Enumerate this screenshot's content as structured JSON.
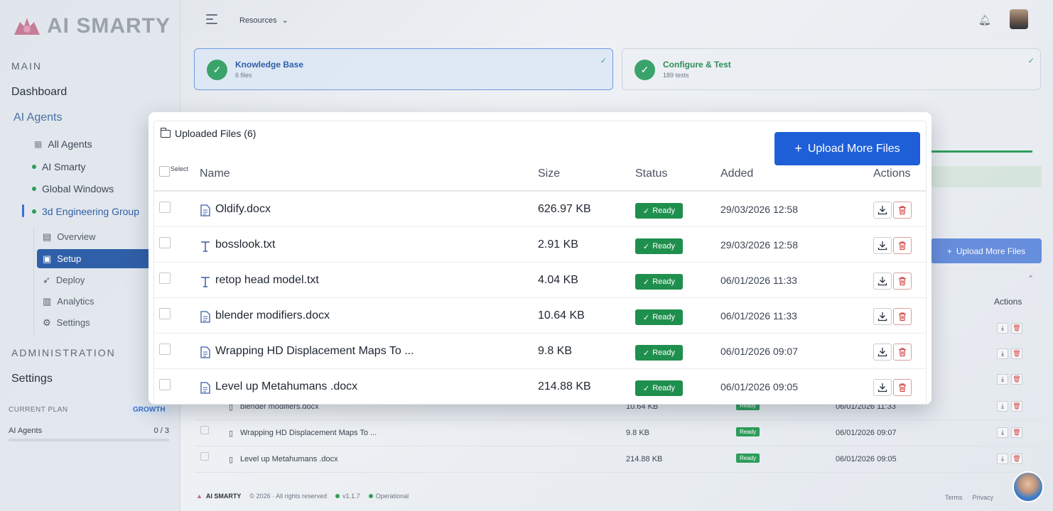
{
  "app": {
    "name": "AI SMARTY"
  },
  "sidebar": {
    "main_label": "MAIN",
    "dashboard": "Dashboard",
    "ai_agents": "AI Agents",
    "agents": [
      {
        "label": "All Agents",
        "icon": "grid-icon"
      },
      {
        "label": "AI Smarty",
        "icon": "status-dot"
      },
      {
        "label": "Global Windows",
        "icon": "status-dot"
      },
      {
        "label": "3d Engineering Group",
        "icon": "status-dot"
      }
    ],
    "agent_subnav": [
      {
        "label": "Overview",
        "icon": "overview-icon"
      },
      {
        "label": "Setup",
        "icon": "setup-icon",
        "active": true
      },
      {
        "label": "Deploy",
        "icon": "deploy-icon"
      },
      {
        "label": "Analytics",
        "icon": "analytics-icon"
      },
      {
        "label": "Settings",
        "icon": "settings-gear-icon"
      }
    ],
    "admin_label": "ADMINISTRATION",
    "settings": "Settings",
    "plan": {
      "label": "CURRENT PLAN",
      "badge": "GROWTH",
      "row_label": "AI Agents",
      "row_value": "0 / 3",
      "usage": 0
    }
  },
  "topbar": {
    "resources": "Resources"
  },
  "steps": [
    {
      "title": "Knowledge Base",
      "sub": "6 files",
      "active": true
    },
    {
      "title": "Configure & Test",
      "sub": "189 tests",
      "active": false
    }
  ],
  "background": {
    "upload_label": "Upload More Files",
    "actions_header": "Actions",
    "rows": [
      {
        "name": "blender modifiers.docx",
        "size": "10.64 KB",
        "status": "Ready",
        "date": "06/01/2026 11:33"
      },
      {
        "name": "Wrapping HD Displacement Maps To ...",
        "size": "9.8 KB",
        "status": "Ready",
        "date": "06/01/2026 09:07"
      },
      {
        "name": "Level up Metahumans .docx",
        "size": "214.88 KB",
        "status": "Ready",
        "date": "06/01/2026 09:05"
      }
    ]
  },
  "footer": {
    "brand": "AI SMARTY",
    "copyright": "© 2026 · All rights reserved",
    "version": "v1.1.7",
    "status": "Operational",
    "terms": "Terms",
    "privacy": "Privacy"
  },
  "modal": {
    "title": "Uploaded Files (6)",
    "upload_button": "Upload More Files",
    "select_label": "Select",
    "columns": {
      "name": "Name",
      "size": "Size",
      "status": "Status",
      "added": "Added",
      "actions": "Actions"
    },
    "files": [
      {
        "name": "Oldify.docx",
        "type": "docx",
        "size": "626.97 KB",
        "status": "Ready",
        "added": "29/03/2026 12:58"
      },
      {
        "name": "bosslook.txt",
        "type": "txt",
        "size": "2.91 KB",
        "status": "Ready",
        "added": "29/03/2026 12:58"
      },
      {
        "name": "retop head model.txt",
        "type": "txt",
        "size": "4.04 KB",
        "status": "Ready",
        "added": "06/01/2026 11:33"
      },
      {
        "name": "blender modifiers.docx",
        "type": "docx",
        "size": "10.64 KB",
        "status": "Ready",
        "added": "06/01/2026 11:33"
      },
      {
        "name": "Wrapping HD Displacement Maps To ...",
        "type": "docx",
        "size": "9.8 KB",
        "status": "Ready",
        "added": "06/01/2026 09:07"
      },
      {
        "name": "Level up Metahumans .docx",
        "type": "docx",
        "size": "214.88 KB",
        "status": "Ready",
        "added": "06/01/2026 09:05"
      }
    ]
  },
  "colors": {
    "primary": "#1e5fd8",
    "success": "#1f8f4d",
    "danger": "#d64545"
  }
}
